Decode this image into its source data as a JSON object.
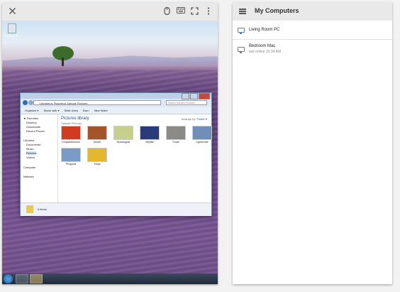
{
  "session": {
    "toolbar_icons": [
      "close-icon",
      "mouse-icon",
      "keyboard-icon",
      "fullscreen-icon",
      "more-vert-icon"
    ],
    "desktop": {
      "recycle_bin_label": "Recycle Bin",
      "explorer": {
        "address": "Libraries ▸ Pictures ▸ Sample Pictures",
        "search_placeholder": "Search Sample Pictures",
        "menu": [
          "Organize ▾",
          "Share with ▾",
          "Slide show",
          "Burn",
          "New folder"
        ],
        "nav": {
          "favorites": "Favorites",
          "desktop": "Desktop",
          "downloads": "Downloads",
          "recent": "Recent Places",
          "libraries": "Libraries",
          "documents": "Documents",
          "music": "Music",
          "pictures": "Pictures",
          "videos": "Videos",
          "computer": "Computer",
          "network": "Network"
        },
        "library_title": "Pictures library",
        "library_subtitle": "Sample Pictures",
        "arrange_by": "Arrange by:",
        "arrange_value": "Folder ▾",
        "thumbnails": [
          {
            "caption": "Chrysanthemum",
            "color": "#d13b1f"
          },
          {
            "caption": "Desert",
            "color": "#a4552a"
          },
          {
            "caption": "Hydrangeas",
            "color": "#c7d08a"
          },
          {
            "caption": "Jellyfish",
            "color": "#2a3a7a"
          },
          {
            "caption": "Koala",
            "color": "#8c8a86"
          },
          {
            "caption": "Lighthouse",
            "color": "#6f8fb8"
          },
          {
            "caption": "Penguins",
            "color": "#7a9bc7"
          },
          {
            "caption": "Tulips",
            "color": "#e4b730"
          }
        ],
        "status": "8 items"
      }
    }
  },
  "sidebar": {
    "title": "My Computers",
    "computers": [
      {
        "name": "Living Room PC",
        "status": "",
        "online": true
      },
      {
        "name": "Bedroom Mac",
        "status": "last online 10:34 AM",
        "online": false
      }
    ]
  }
}
